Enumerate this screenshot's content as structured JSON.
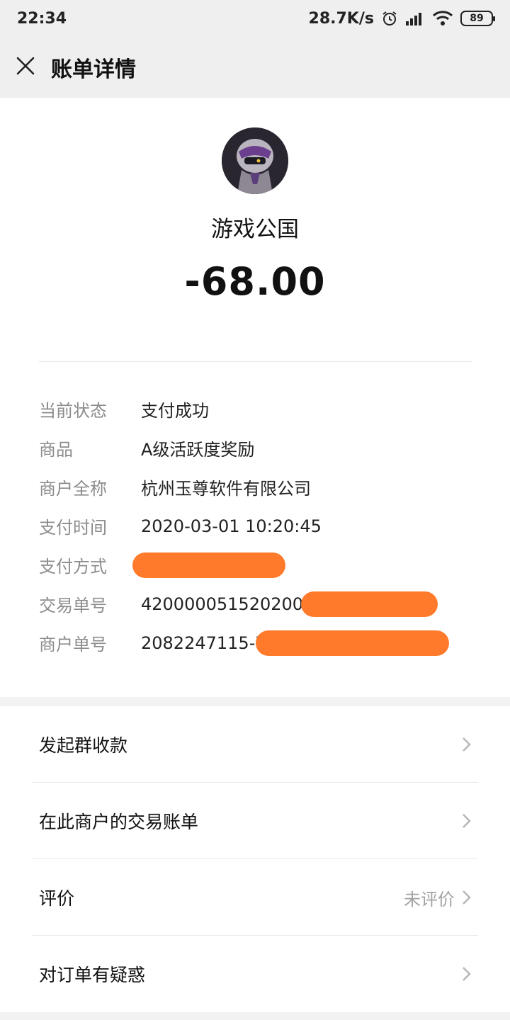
{
  "status_bar": {
    "time": "22:34",
    "network_speed": "28.7K/s",
    "battery": "89",
    "icons": [
      "alarm-icon",
      "signal-icon",
      "wifi-icon",
      "battery-icon"
    ]
  },
  "header": {
    "title": "账单详情",
    "close_icon": "close-icon"
  },
  "summary": {
    "merchant_name": "游戏公国",
    "amount": "-68.00"
  },
  "details": [
    {
      "label": "当前状态",
      "value": "支付成功"
    },
    {
      "label": "商品",
      "value": "A级活跃度奖励"
    },
    {
      "label": "商户全称",
      "value": "杭州玉尊软件有限公司"
    },
    {
      "label": "支付时间",
      "value": "2020-03-01 10:20:45"
    },
    {
      "label": "支付方式",
      "value": ""
    },
    {
      "label": "交易单号",
      "value": "4200000515202003"
    },
    {
      "label": "商户单号",
      "value": "2082247115-7"
    }
  ],
  "menu": [
    {
      "label": "发起群收款",
      "right_text": ""
    },
    {
      "label": "在此商户的交易账单",
      "right_text": ""
    },
    {
      "label": "评价",
      "right_text": "未评价"
    },
    {
      "label": "对订单有疑惑",
      "right_text": ""
    }
  ],
  "colors": {
    "redaction": "#ff7a2b",
    "label_gray": "#8c8c8c",
    "background": "#f2f2f2"
  }
}
